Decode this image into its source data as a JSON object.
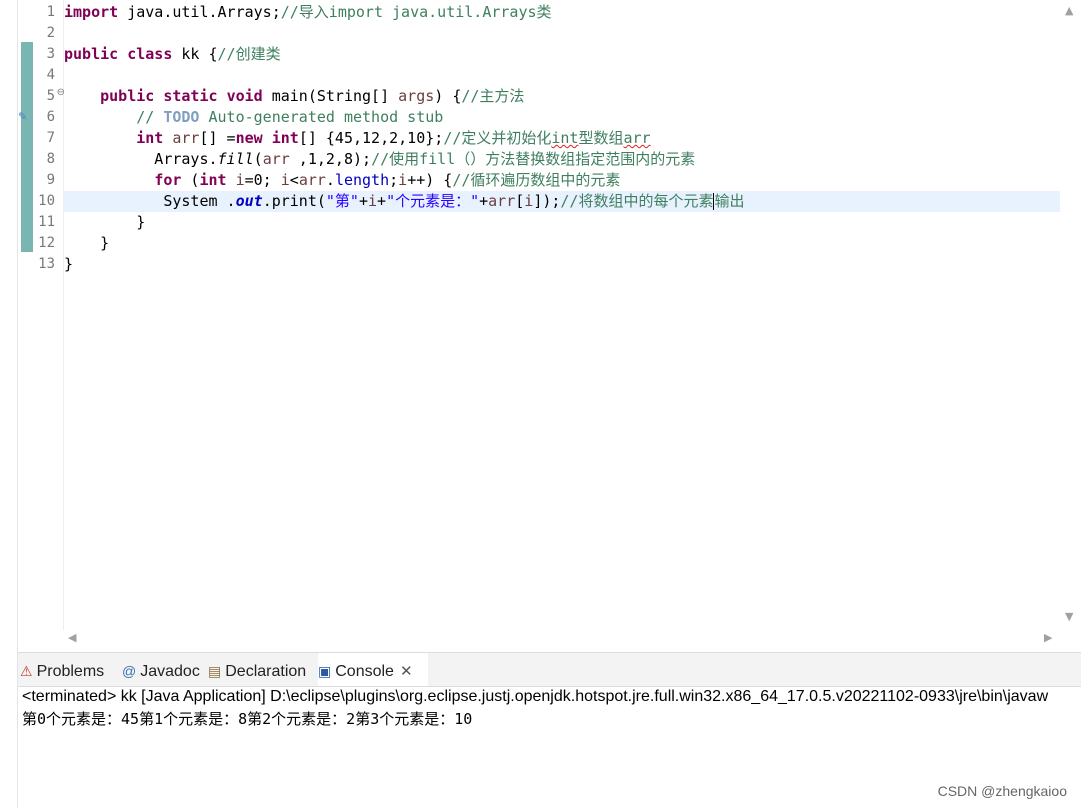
{
  "editor": {
    "line_numbers": [
      "1",
      "2",
      "3",
      "4",
      "5",
      "6",
      "7",
      "8",
      "9",
      "10",
      "11",
      "12",
      "13"
    ],
    "fold_marker": "⊖",
    "lines": [
      [
        {
          "t": "kw",
          "v": "import"
        },
        {
          "t": "",
          "v": " java.util.Arrays;"
        },
        {
          "t": "cm",
          "v": "//导入import java.util.Arrays类"
        }
      ],
      [],
      [
        {
          "t": "kw",
          "v": "public"
        },
        {
          "t": "",
          "v": " "
        },
        {
          "t": "kw",
          "v": "class"
        },
        {
          "t": "",
          "v": " kk {"
        },
        {
          "t": "cm",
          "v": "//创建类"
        }
      ],
      [],
      [
        {
          "t": "",
          "v": "    "
        },
        {
          "t": "kw",
          "v": "public"
        },
        {
          "t": "",
          "v": " "
        },
        {
          "t": "kw",
          "v": "static"
        },
        {
          "t": "",
          "v": " "
        },
        {
          "t": "kw",
          "v": "void"
        },
        {
          "t": "",
          "v": " main(String[] "
        },
        {
          "t": "var",
          "v": "args"
        },
        {
          "t": "",
          "v": ") {"
        },
        {
          "t": "cm",
          "v": "//主方法"
        }
      ],
      [
        {
          "t": "",
          "v": "        "
        },
        {
          "t": "cm",
          "v": "// "
        },
        {
          "t": "todo",
          "v": "TODO"
        },
        {
          "t": "cm",
          "v": " Auto-generated method stub"
        }
      ],
      [
        {
          "t": "",
          "v": "        "
        },
        {
          "t": "kw",
          "v": "int"
        },
        {
          "t": "",
          "v": " "
        },
        {
          "t": "var",
          "v": "arr"
        },
        {
          "t": "",
          "v": "[] ="
        },
        {
          "t": "kw",
          "v": "new"
        },
        {
          "t": "",
          "v": " "
        },
        {
          "t": "kw",
          "v": "int"
        },
        {
          "t": "",
          "v": "[] {45,12,2,10};"
        },
        {
          "t": "cm",
          "v": "//定义并初始化"
        },
        {
          "t": "cm squig",
          "v": "int"
        },
        {
          "t": "cm",
          "v": "型数组"
        },
        {
          "t": "cm squig",
          "v": "arr"
        }
      ],
      [
        {
          "t": "",
          "v": "          Arrays."
        },
        {
          "t": "mth",
          "v": "fill"
        },
        {
          "t": "",
          "v": "("
        },
        {
          "t": "var",
          "v": "arr"
        },
        {
          "t": "",
          "v": " ,1,2,8);"
        },
        {
          "t": "cm",
          "v": "//使用fill（）方法替换数组指定范围内的元素"
        }
      ],
      [
        {
          "t": "",
          "v": "          "
        },
        {
          "t": "kw",
          "v": "for"
        },
        {
          "t": "",
          "v": " ("
        },
        {
          "t": "kw",
          "v": "int"
        },
        {
          "t": "",
          "v": " "
        },
        {
          "t": "var",
          "v": "i"
        },
        {
          "t": "",
          "v": "=0; "
        },
        {
          "t": "var",
          "v": "i"
        },
        {
          "t": "",
          "v": "<"
        },
        {
          "t": "var",
          "v": "arr"
        },
        {
          "t": "",
          "v": "."
        },
        {
          "t": "fld",
          "v": "length"
        },
        {
          "t": "",
          "v": ";"
        },
        {
          "t": "var",
          "v": "i"
        },
        {
          "t": "",
          "v": "++) {"
        },
        {
          "t": "cm",
          "v": "//循环遍历数组中的元素"
        }
      ],
      [
        {
          "t": "",
          "v": "           System ."
        },
        {
          "t": "sfld",
          "v": "out"
        },
        {
          "t": "",
          "v": ".print("
        },
        {
          "t": "str",
          "v": "\"第\""
        },
        {
          "t": "",
          "v": "+"
        },
        {
          "t": "var",
          "v": "i"
        },
        {
          "t": "",
          "v": "+"
        },
        {
          "t": "str",
          "v": "\"个元素是：\""
        },
        {
          "t": "",
          "v": "+"
        },
        {
          "t": "var",
          "v": "arr"
        },
        {
          "t": "",
          "v": "["
        },
        {
          "t": "var",
          "v": "i"
        },
        {
          "t": "",
          "v": "]);"
        },
        {
          "t": "cm",
          "v": "//将数组中的每个元素"
        },
        {
          "t": "caret",
          "v": ""
        },
        {
          "t": "cm",
          "v": "输出"
        }
      ],
      [
        {
          "t": "",
          "v": "        }"
        }
      ],
      [
        {
          "t": "",
          "v": "    }"
        }
      ],
      [
        {
          "t": "",
          "v": "}"
        }
      ]
    ],
    "current_line": 10
  },
  "console": {
    "tabs": [
      {
        "label": "Problems",
        "icon": "problems-icon",
        "glyph": "⚠",
        "icon_color": "#c0392b"
      },
      {
        "label": "Javadoc",
        "icon": "javadoc-icon",
        "glyph": "@",
        "icon_color": "#3b6fb6"
      },
      {
        "label": "Declaration",
        "icon": "declaration-icon",
        "glyph": "▤",
        "icon_color": "#8a6d3b"
      },
      {
        "label": "Console",
        "icon": "console-icon",
        "glyph": "▣",
        "icon_color": "#2c5aa0",
        "active": true
      }
    ],
    "close_label": "✕",
    "status": "<terminated> kk [Java Application] D:\\eclipse\\plugins\\org.eclipse.justj.openjdk.hotspot.jre.full.win32.x86_64_17.0.5.v20221102-0933\\jre\\bin\\javaw",
    "output": "第0个元素是：45第1个元素是：8第2个元素是：2第3个元素是：10"
  },
  "watermark": "CSDN @zhengkaioo"
}
